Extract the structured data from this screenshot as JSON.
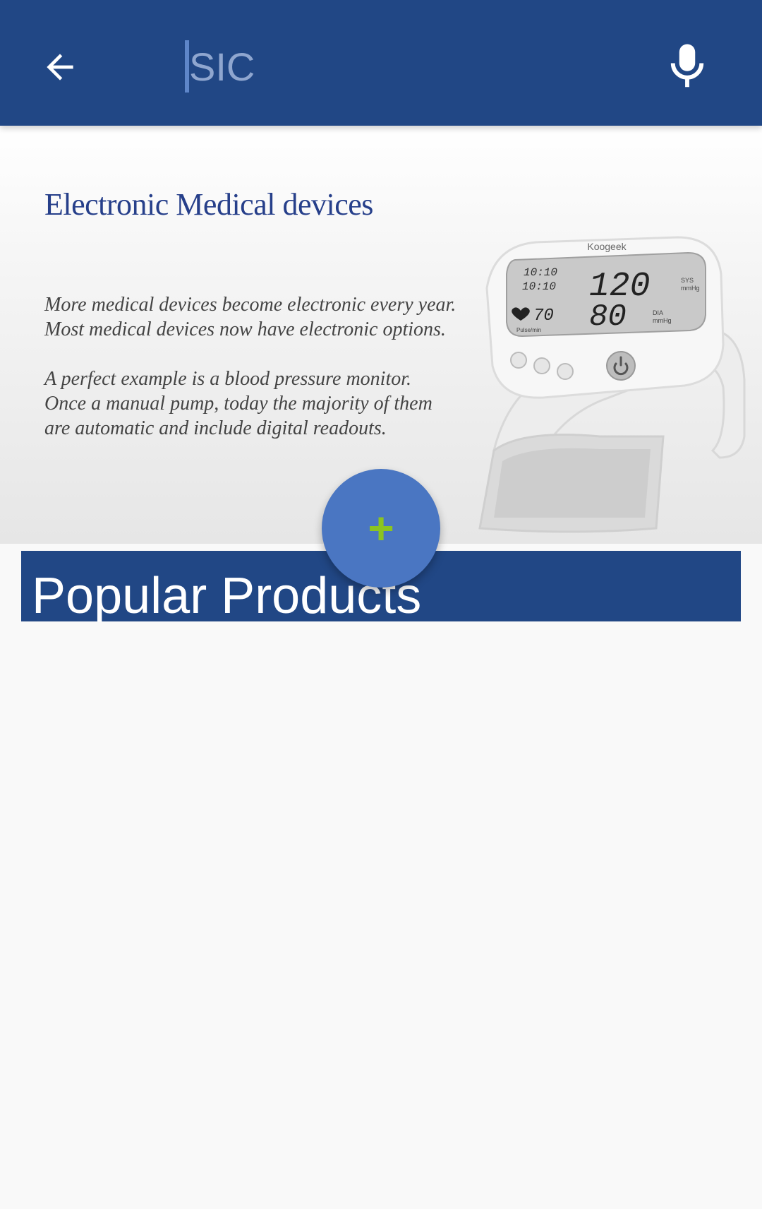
{
  "toolbar": {
    "search": {
      "value": "SIC",
      "placeholder": ""
    },
    "icons": {
      "back": "arrow-back-icon",
      "mic": "microphone-icon"
    }
  },
  "banner": {
    "title": "Electronic Medical devices",
    "paragraph1_line1": "More medical devices become electronic every year.",
    "paragraph1_line2": "Most medical devices now have electronic options.",
    "paragraph2_line1": "A perfect example is a blood pressure monitor.",
    "paragraph2_line2": "Once a manual pump, today the majority of them",
    "paragraph2_line3": "are automatic and include digital readouts.",
    "device": {
      "brand": "Koogeek",
      "time1": "10:10",
      "time2": "10:10",
      "sys": "120",
      "sys_label": "SYS",
      "dia": "80",
      "dia_label": "DIA",
      "unit": "mmHg",
      "pulse": "70",
      "pulse_label": "Pulse/min"
    }
  },
  "fab": {
    "symbol": "+"
  },
  "section": {
    "title": "Popular Products"
  },
  "colors": {
    "primary": "#214785",
    "fab": "#4a76c2",
    "fab_plus": "#8bc420",
    "title_text": "#263f8a",
    "background": "#f9f9f9"
  }
}
